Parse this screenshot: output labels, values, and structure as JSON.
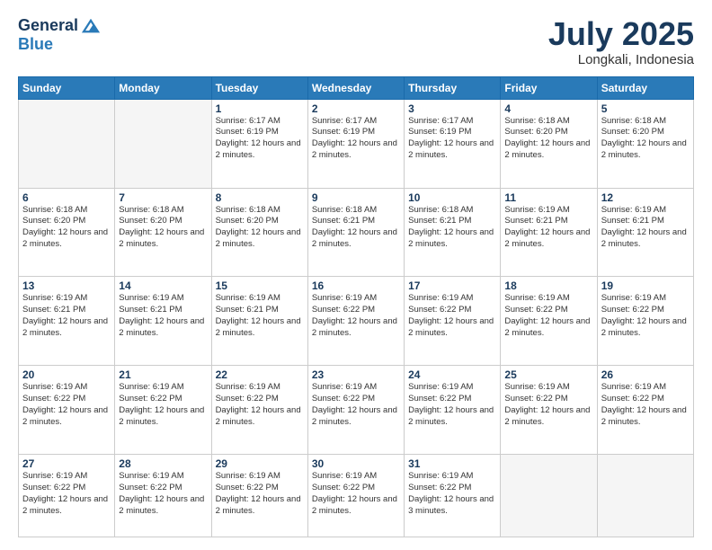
{
  "logo": {
    "general": "General",
    "blue": "Blue"
  },
  "title": "July 2025",
  "location": "Longkali, Indonesia",
  "days_of_week": [
    "Sunday",
    "Monday",
    "Tuesday",
    "Wednesday",
    "Thursday",
    "Friday",
    "Saturday"
  ],
  "weeks": [
    [
      {
        "day": "",
        "info": ""
      },
      {
        "day": "",
        "info": ""
      },
      {
        "day": "1",
        "info": "Sunrise: 6:17 AM\nSunset: 6:19 PM\nDaylight: 12 hours\nand 2 minutes."
      },
      {
        "day": "2",
        "info": "Sunrise: 6:17 AM\nSunset: 6:19 PM\nDaylight: 12 hours\nand 2 minutes."
      },
      {
        "day": "3",
        "info": "Sunrise: 6:17 AM\nSunset: 6:19 PM\nDaylight: 12 hours\nand 2 minutes."
      },
      {
        "day": "4",
        "info": "Sunrise: 6:18 AM\nSunset: 6:20 PM\nDaylight: 12 hours\nand 2 minutes."
      },
      {
        "day": "5",
        "info": "Sunrise: 6:18 AM\nSunset: 6:20 PM\nDaylight: 12 hours\nand 2 minutes."
      }
    ],
    [
      {
        "day": "6",
        "info": "Sunrise: 6:18 AM\nSunset: 6:20 PM\nDaylight: 12 hours\nand 2 minutes."
      },
      {
        "day": "7",
        "info": "Sunrise: 6:18 AM\nSunset: 6:20 PM\nDaylight: 12 hours\nand 2 minutes."
      },
      {
        "day": "8",
        "info": "Sunrise: 6:18 AM\nSunset: 6:20 PM\nDaylight: 12 hours\nand 2 minutes."
      },
      {
        "day": "9",
        "info": "Sunrise: 6:18 AM\nSunset: 6:21 PM\nDaylight: 12 hours\nand 2 minutes."
      },
      {
        "day": "10",
        "info": "Sunrise: 6:18 AM\nSunset: 6:21 PM\nDaylight: 12 hours\nand 2 minutes."
      },
      {
        "day": "11",
        "info": "Sunrise: 6:19 AM\nSunset: 6:21 PM\nDaylight: 12 hours\nand 2 minutes."
      },
      {
        "day": "12",
        "info": "Sunrise: 6:19 AM\nSunset: 6:21 PM\nDaylight: 12 hours\nand 2 minutes."
      }
    ],
    [
      {
        "day": "13",
        "info": "Sunrise: 6:19 AM\nSunset: 6:21 PM\nDaylight: 12 hours\nand 2 minutes."
      },
      {
        "day": "14",
        "info": "Sunrise: 6:19 AM\nSunset: 6:21 PM\nDaylight: 12 hours\nand 2 minutes."
      },
      {
        "day": "15",
        "info": "Sunrise: 6:19 AM\nSunset: 6:21 PM\nDaylight: 12 hours\nand 2 minutes."
      },
      {
        "day": "16",
        "info": "Sunrise: 6:19 AM\nSunset: 6:22 PM\nDaylight: 12 hours\nand 2 minutes."
      },
      {
        "day": "17",
        "info": "Sunrise: 6:19 AM\nSunset: 6:22 PM\nDaylight: 12 hours\nand 2 minutes."
      },
      {
        "day": "18",
        "info": "Sunrise: 6:19 AM\nSunset: 6:22 PM\nDaylight: 12 hours\nand 2 minutes."
      },
      {
        "day": "19",
        "info": "Sunrise: 6:19 AM\nSunset: 6:22 PM\nDaylight: 12 hours\nand 2 minutes."
      }
    ],
    [
      {
        "day": "20",
        "info": "Sunrise: 6:19 AM\nSunset: 6:22 PM\nDaylight: 12 hours\nand 2 minutes."
      },
      {
        "day": "21",
        "info": "Sunrise: 6:19 AM\nSunset: 6:22 PM\nDaylight: 12 hours\nand 2 minutes."
      },
      {
        "day": "22",
        "info": "Sunrise: 6:19 AM\nSunset: 6:22 PM\nDaylight: 12 hours\nand 2 minutes."
      },
      {
        "day": "23",
        "info": "Sunrise: 6:19 AM\nSunset: 6:22 PM\nDaylight: 12 hours\nand 2 minutes."
      },
      {
        "day": "24",
        "info": "Sunrise: 6:19 AM\nSunset: 6:22 PM\nDaylight: 12 hours\nand 2 minutes."
      },
      {
        "day": "25",
        "info": "Sunrise: 6:19 AM\nSunset: 6:22 PM\nDaylight: 12 hours\nand 2 minutes."
      },
      {
        "day": "26",
        "info": "Sunrise: 6:19 AM\nSunset: 6:22 PM\nDaylight: 12 hours\nand 2 minutes."
      }
    ],
    [
      {
        "day": "27",
        "info": "Sunrise: 6:19 AM\nSunset: 6:22 PM\nDaylight: 12 hours\nand 2 minutes."
      },
      {
        "day": "28",
        "info": "Sunrise: 6:19 AM\nSunset: 6:22 PM\nDaylight: 12 hours\nand 2 minutes."
      },
      {
        "day": "29",
        "info": "Sunrise: 6:19 AM\nSunset: 6:22 PM\nDaylight: 12 hours\nand 2 minutes."
      },
      {
        "day": "30",
        "info": "Sunrise: 6:19 AM\nSunset: 6:22 PM\nDaylight: 12 hours\nand 2 minutes."
      },
      {
        "day": "31",
        "info": "Sunrise: 6:19 AM\nSunset: 6:22 PM\nDaylight: 12 hours\nand 3 minutes."
      },
      {
        "day": "",
        "info": ""
      },
      {
        "day": "",
        "info": ""
      }
    ]
  ]
}
